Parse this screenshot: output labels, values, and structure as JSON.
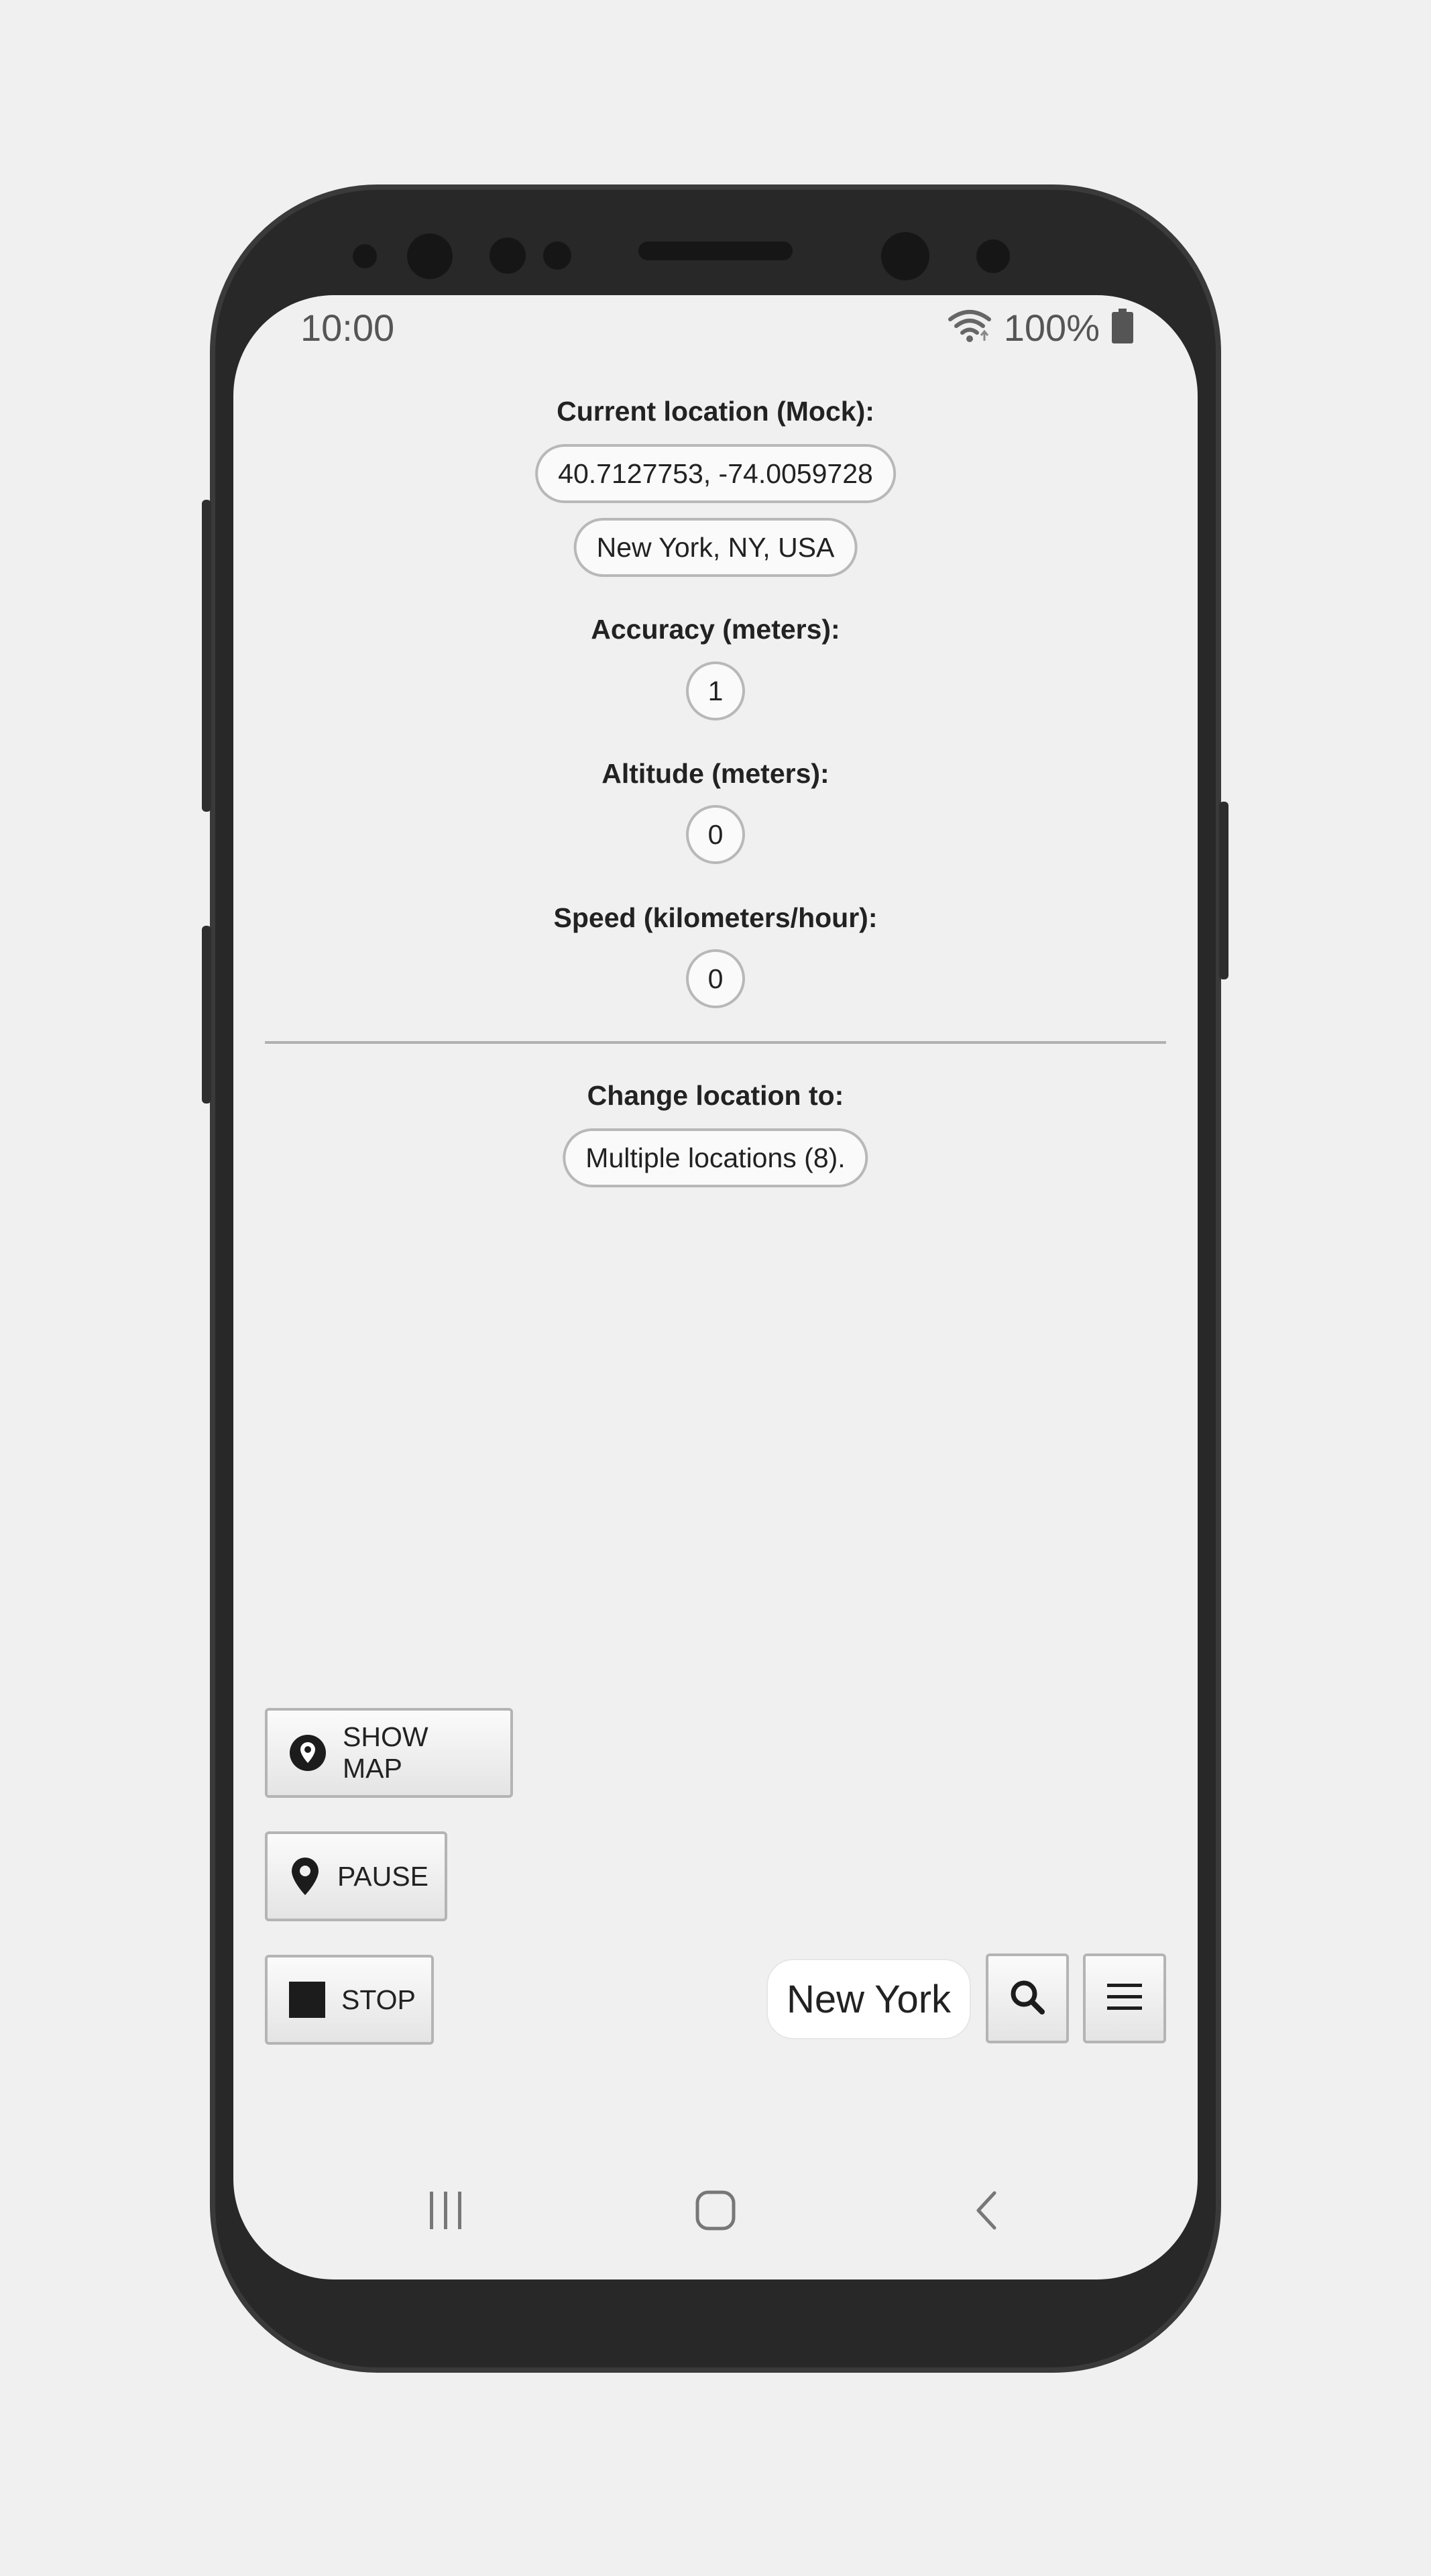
{
  "status_bar": {
    "time": "10:00",
    "battery_percent": "100%",
    "icons": [
      "wifi-icon",
      "battery-icon"
    ]
  },
  "location": {
    "current_label": "Current location (Mock):",
    "coordinates": "40.7127753, -74.0059728",
    "address": "New York, NY, USA",
    "accuracy_label": "Accuracy (meters):",
    "accuracy_value": "1",
    "altitude_label": "Altitude (meters):",
    "altitude_value": "0",
    "speed_label": "Speed (kilometers/hour):",
    "speed_value": "0",
    "change_label": "Change location to:",
    "change_value": "Multiple locations (8)."
  },
  "actions": {
    "show_map": "SHOW MAP",
    "pause": "PAUSE",
    "stop": "STOP",
    "city": "New York"
  },
  "nav": {
    "icons": [
      "recent-apps-icon",
      "home-icon",
      "back-icon"
    ]
  },
  "colors": {
    "phone_body": "#282828",
    "screen_bg": "#f0f0f0",
    "pill_border": "#b8b8b8",
    "text": "#222222"
  }
}
